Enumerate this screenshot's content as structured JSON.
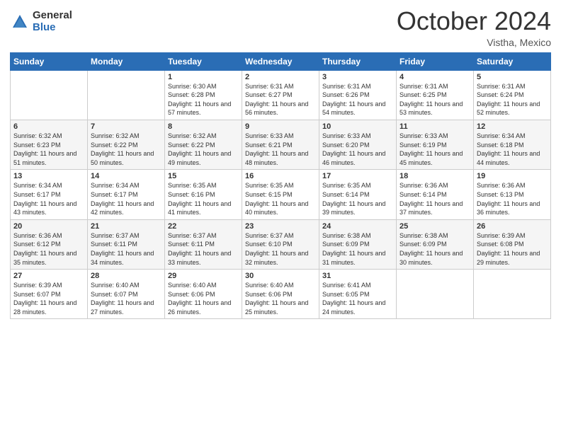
{
  "logo": {
    "general": "General",
    "blue": "Blue"
  },
  "header": {
    "month": "October 2024",
    "location": "Vistha, Mexico"
  },
  "weekdays": [
    "Sunday",
    "Monday",
    "Tuesday",
    "Wednesday",
    "Thursday",
    "Friday",
    "Saturday"
  ],
  "weeks": [
    [
      {
        "day": "",
        "sunrise": "",
        "sunset": "",
        "daylight": ""
      },
      {
        "day": "",
        "sunrise": "",
        "sunset": "",
        "daylight": ""
      },
      {
        "day": "1",
        "sunrise": "Sunrise: 6:30 AM",
        "sunset": "Sunset: 6:28 PM",
        "daylight": "Daylight: 11 hours and 57 minutes."
      },
      {
        "day": "2",
        "sunrise": "Sunrise: 6:31 AM",
        "sunset": "Sunset: 6:27 PM",
        "daylight": "Daylight: 11 hours and 56 minutes."
      },
      {
        "day": "3",
        "sunrise": "Sunrise: 6:31 AM",
        "sunset": "Sunset: 6:26 PM",
        "daylight": "Daylight: 11 hours and 54 minutes."
      },
      {
        "day": "4",
        "sunrise": "Sunrise: 6:31 AM",
        "sunset": "Sunset: 6:25 PM",
        "daylight": "Daylight: 11 hours and 53 minutes."
      },
      {
        "day": "5",
        "sunrise": "Sunrise: 6:31 AM",
        "sunset": "Sunset: 6:24 PM",
        "daylight": "Daylight: 11 hours and 52 minutes."
      }
    ],
    [
      {
        "day": "6",
        "sunrise": "Sunrise: 6:32 AM",
        "sunset": "Sunset: 6:23 PM",
        "daylight": "Daylight: 11 hours and 51 minutes."
      },
      {
        "day": "7",
        "sunrise": "Sunrise: 6:32 AM",
        "sunset": "Sunset: 6:22 PM",
        "daylight": "Daylight: 11 hours and 50 minutes."
      },
      {
        "day": "8",
        "sunrise": "Sunrise: 6:32 AM",
        "sunset": "Sunset: 6:22 PM",
        "daylight": "Daylight: 11 hours and 49 minutes."
      },
      {
        "day": "9",
        "sunrise": "Sunrise: 6:33 AM",
        "sunset": "Sunset: 6:21 PM",
        "daylight": "Daylight: 11 hours and 48 minutes."
      },
      {
        "day": "10",
        "sunrise": "Sunrise: 6:33 AM",
        "sunset": "Sunset: 6:20 PM",
        "daylight": "Daylight: 11 hours and 46 minutes."
      },
      {
        "day": "11",
        "sunrise": "Sunrise: 6:33 AM",
        "sunset": "Sunset: 6:19 PM",
        "daylight": "Daylight: 11 hours and 45 minutes."
      },
      {
        "day": "12",
        "sunrise": "Sunrise: 6:34 AM",
        "sunset": "Sunset: 6:18 PM",
        "daylight": "Daylight: 11 hours and 44 minutes."
      }
    ],
    [
      {
        "day": "13",
        "sunrise": "Sunrise: 6:34 AM",
        "sunset": "Sunset: 6:17 PM",
        "daylight": "Daylight: 11 hours and 43 minutes."
      },
      {
        "day": "14",
        "sunrise": "Sunrise: 6:34 AM",
        "sunset": "Sunset: 6:17 PM",
        "daylight": "Daylight: 11 hours and 42 minutes."
      },
      {
        "day": "15",
        "sunrise": "Sunrise: 6:35 AM",
        "sunset": "Sunset: 6:16 PM",
        "daylight": "Daylight: 11 hours and 41 minutes."
      },
      {
        "day": "16",
        "sunrise": "Sunrise: 6:35 AM",
        "sunset": "Sunset: 6:15 PM",
        "daylight": "Daylight: 11 hours and 40 minutes."
      },
      {
        "day": "17",
        "sunrise": "Sunrise: 6:35 AM",
        "sunset": "Sunset: 6:14 PM",
        "daylight": "Daylight: 11 hours and 39 minutes."
      },
      {
        "day": "18",
        "sunrise": "Sunrise: 6:36 AM",
        "sunset": "Sunset: 6:14 PM",
        "daylight": "Daylight: 11 hours and 37 minutes."
      },
      {
        "day": "19",
        "sunrise": "Sunrise: 6:36 AM",
        "sunset": "Sunset: 6:13 PM",
        "daylight": "Daylight: 11 hours and 36 minutes."
      }
    ],
    [
      {
        "day": "20",
        "sunrise": "Sunrise: 6:36 AM",
        "sunset": "Sunset: 6:12 PM",
        "daylight": "Daylight: 11 hours and 35 minutes."
      },
      {
        "day": "21",
        "sunrise": "Sunrise: 6:37 AM",
        "sunset": "Sunset: 6:11 PM",
        "daylight": "Daylight: 11 hours and 34 minutes."
      },
      {
        "day": "22",
        "sunrise": "Sunrise: 6:37 AM",
        "sunset": "Sunset: 6:11 PM",
        "daylight": "Daylight: 11 hours and 33 minutes."
      },
      {
        "day": "23",
        "sunrise": "Sunrise: 6:37 AM",
        "sunset": "Sunset: 6:10 PM",
        "daylight": "Daylight: 11 hours and 32 minutes."
      },
      {
        "day": "24",
        "sunrise": "Sunrise: 6:38 AM",
        "sunset": "Sunset: 6:09 PM",
        "daylight": "Daylight: 11 hours and 31 minutes."
      },
      {
        "day": "25",
        "sunrise": "Sunrise: 6:38 AM",
        "sunset": "Sunset: 6:09 PM",
        "daylight": "Daylight: 11 hours and 30 minutes."
      },
      {
        "day": "26",
        "sunrise": "Sunrise: 6:39 AM",
        "sunset": "Sunset: 6:08 PM",
        "daylight": "Daylight: 11 hours and 29 minutes."
      }
    ],
    [
      {
        "day": "27",
        "sunrise": "Sunrise: 6:39 AM",
        "sunset": "Sunset: 6:07 PM",
        "daylight": "Daylight: 11 hours and 28 minutes."
      },
      {
        "day": "28",
        "sunrise": "Sunrise: 6:40 AM",
        "sunset": "Sunset: 6:07 PM",
        "daylight": "Daylight: 11 hours and 27 minutes."
      },
      {
        "day": "29",
        "sunrise": "Sunrise: 6:40 AM",
        "sunset": "Sunset: 6:06 PM",
        "daylight": "Daylight: 11 hours and 26 minutes."
      },
      {
        "day": "30",
        "sunrise": "Sunrise: 6:40 AM",
        "sunset": "Sunset: 6:06 PM",
        "daylight": "Daylight: 11 hours and 25 minutes."
      },
      {
        "day": "31",
        "sunrise": "Sunrise: 6:41 AM",
        "sunset": "Sunset: 6:05 PM",
        "daylight": "Daylight: 11 hours and 24 minutes."
      },
      {
        "day": "",
        "sunrise": "",
        "sunset": "",
        "daylight": ""
      },
      {
        "day": "",
        "sunrise": "",
        "sunset": "",
        "daylight": ""
      }
    ]
  ]
}
